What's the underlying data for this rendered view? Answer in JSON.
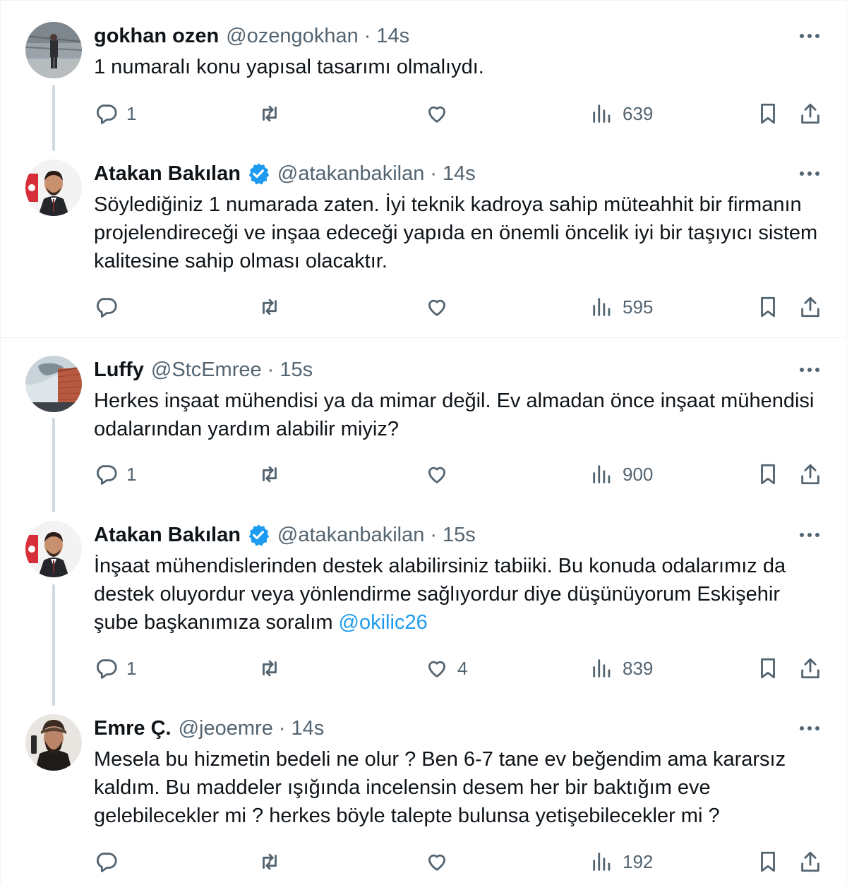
{
  "tweets": [
    {
      "name": "gokhan ozen",
      "verified": false,
      "handle": "@ozengokhan",
      "time": "14s",
      "text": "1 numaralı konu yapısal tasarımı olmalıydı.",
      "mention": "",
      "replies": "1",
      "retweets": "",
      "likes": "",
      "views": "639"
    },
    {
      "name": "Atakan Bakılan",
      "verified": true,
      "handle": "@atakanbakilan",
      "time": "14s",
      "text": "Söylediğiniz 1 numarada zaten. İyi teknik kadroya sahip müteahhit bir firmanın projelendireceği ve inşaa edeceği yapıda en önemli öncelik iyi bir taşıyıcı sistem kalitesine sahip olması olacaktır.",
      "mention": "",
      "replies": "",
      "retweets": "",
      "likes": "",
      "views": "595"
    },
    {
      "name": "Luffy",
      "verified": false,
      "handle": "@StcEmree",
      "time": "15s",
      "text": "Herkes inşaat mühendisi ya da mimar değil. Ev almadan önce inşaat mühendisi odalarından yardım alabilir miyiz?",
      "mention": "",
      "replies": "1",
      "retweets": "",
      "likes": "",
      "views": "900"
    },
    {
      "name": "Atakan Bakılan",
      "verified": true,
      "handle": "@atakanbakilan",
      "time": "15s",
      "text": "İnşaat mühendislerinden destek alabilirsiniz tabiiki. Bu konuda odalarımız da destek oluyordur veya yönlendirme sağlıyordur diye düşünüyorum Eskişehir şube başkanımıza soralım ",
      "mention": "@okilic26",
      "replies": "1",
      "retweets": "",
      "likes": "4",
      "views": "839"
    },
    {
      "name": "Emre Ç.",
      "verified": false,
      "handle": "@jeoemre",
      "time": "14s",
      "text": "Mesela bu hizmetin bedeli ne olur ? Ben 6-7 tane ev beğendim ama kararsız kaldım. Bu maddeler ışığında incelensin desem her bir baktığım eve gelebilecekler mi ? herkes böyle talepte bulunsa yetişebilecekler mi ?",
      "mention": "",
      "replies": "",
      "retweets": "",
      "likes": "",
      "views": "192"
    }
  ],
  "separator": "·",
  "colors": {
    "text": "#0f1419",
    "secondary": "#536471",
    "accent": "#1d9bf0",
    "thread_line": "#cfd9de",
    "divider": "#eff3f4"
  },
  "icons": {
    "reply": "reply-icon",
    "retweet": "retweet-icon",
    "like": "like-icon",
    "views": "views-icon",
    "bookmark": "bookmark-icon",
    "share": "share-icon",
    "more": "more-icon",
    "verified": "verified-badge-icon"
  }
}
